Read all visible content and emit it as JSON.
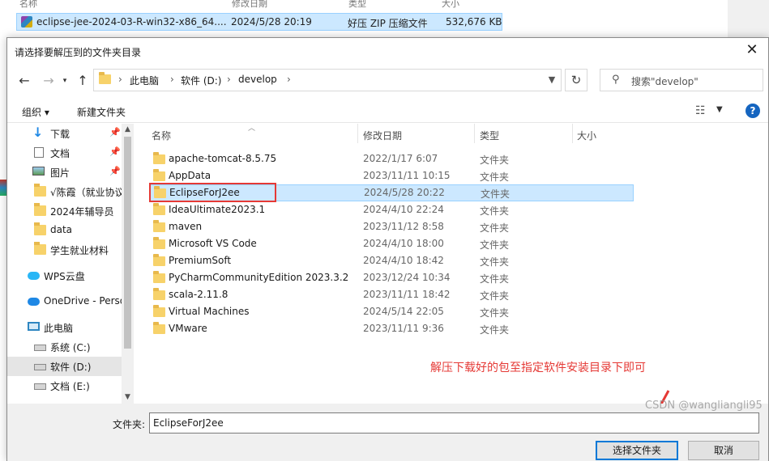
{
  "background_window": {
    "columns": [
      "名称",
      "修改日期",
      "类型",
      "大小"
    ],
    "selected_file": {
      "name": "eclipse-jee-2024-03-R-win32-x86_64....",
      "date": "2024/5/28 20:19",
      "type": "好压 ZIP 压缩文件",
      "size": "532,676 KB"
    }
  },
  "dialog": {
    "title": "请选择要解压到的文件夹目录",
    "close_glyph": "✕",
    "nav": {
      "back": "←",
      "forward": "→",
      "up": "↑"
    },
    "breadcrumb": [
      "此电脑",
      "软件 (D:)",
      "develop"
    ],
    "search_placeholder": "搜索\"develop\"",
    "toolbar": {
      "organize": "组织 ▾",
      "new_folder": "新建文件夹"
    },
    "sidebar": [
      {
        "label": "下载",
        "icon": "download-arrow-icon",
        "pinned": true
      },
      {
        "label": "文档",
        "icon": "document-icon",
        "pinned": true
      },
      {
        "label": "图片",
        "icon": "picture-icon",
        "pinned": true
      },
      {
        "label": "√陈霞（就业协议",
        "icon": "folder-icon",
        "pinned": false
      },
      {
        "label": "2024年辅导员",
        "icon": "folder-icon",
        "pinned": false
      },
      {
        "label": "data",
        "icon": "folder-icon",
        "pinned": false
      },
      {
        "label": "学生就业材料",
        "icon": "folder-icon",
        "pinned": false
      },
      {
        "label": "WPS云盘",
        "icon": "wps-cloud-icon",
        "pinned": false
      },
      {
        "label": "OneDrive - Perso",
        "icon": "onedrive-cloud-icon",
        "pinned": false
      },
      {
        "label": "此电脑",
        "icon": "computer-icon",
        "pinned": false
      },
      {
        "label": "系统 (C:)",
        "icon": "drive-icon",
        "pinned": false
      },
      {
        "label": "软件 (D:)",
        "icon": "drive-icon",
        "pinned": false,
        "selected": true
      },
      {
        "label": "文档 (E:)",
        "icon": "drive-icon",
        "pinned": false
      }
    ],
    "columns": {
      "name": "名称",
      "date": "修改日期",
      "type": "类型",
      "size": "大小"
    },
    "files": [
      {
        "name": "apache-tomcat-8.5.75",
        "date": "2022/1/17 6:07",
        "type": "文件夹"
      },
      {
        "name": "AppData",
        "date": "2023/11/11 10:15",
        "type": "文件夹"
      },
      {
        "name": "EclipseForJ2ee",
        "date": "2024/5/28 20:22",
        "type": "文件夹",
        "selected": true
      },
      {
        "name": "IdeaUltimate2023.1",
        "date": "2024/4/10 22:24",
        "type": "文件夹"
      },
      {
        "name": "maven",
        "date": "2023/11/12 8:58",
        "type": "文件夹"
      },
      {
        "name": "Microsoft VS Code",
        "date": "2024/4/10 18:00",
        "type": "文件夹"
      },
      {
        "name": "PremiumSoft",
        "date": "2024/4/10 18:42",
        "type": "文件夹"
      },
      {
        "name": "PyCharmCommunityEdition 2023.3.2",
        "date": "2023/12/24 10:34",
        "type": "文件夹"
      },
      {
        "name": "scala-2.11.8",
        "date": "2023/11/11 18:42",
        "type": "文件夹"
      },
      {
        "name": "Virtual Machines",
        "date": "2024/5/14 22:05",
        "type": "文件夹"
      },
      {
        "name": "VMware",
        "date": "2023/11/11 9:36",
        "type": "文件夹"
      }
    ],
    "annotation": "解压下载好的包至指定软件安装目录下即可",
    "annotation_color": "#e53935",
    "filename_label": "文件夹:",
    "filename_value": "EclipseForJ2ee",
    "select_button": "选择文件夹",
    "cancel_button": "取消",
    "watermark": "CSDN @wangliangli95"
  }
}
